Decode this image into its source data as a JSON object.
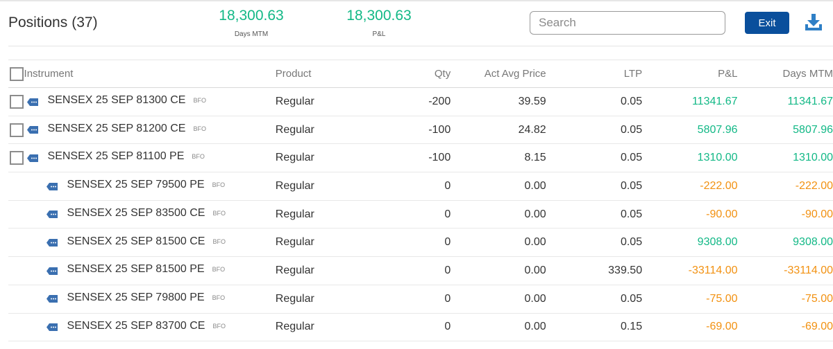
{
  "header": {
    "title": "Positions",
    "count": "(37)",
    "days_mtm_value": "18,300.63",
    "days_mtm_label": "Days MTM",
    "pnl_value": "18,300.63",
    "pnl_label": "P&L",
    "search_placeholder": "Search",
    "exit_label": "Exit"
  },
  "columns": {
    "instrument": "Instrument",
    "product": "Product",
    "qty": "Qty",
    "avg": "Act Avg Price",
    "ltp": "LTP",
    "pnl": "P&L",
    "mtm": "Days MTM"
  },
  "colors": {
    "profit": "#12b886",
    "loss": "#f29111",
    "accent": "#0a4f9c"
  },
  "rows": [
    {
      "instrument": "SENSEX 25 SEP 81300 CE",
      "exchange": "BFO",
      "product": "Regular",
      "qty": "-200",
      "avg": "39.59",
      "ltp": "0.05",
      "pnl": "11341.67",
      "mtm": "11341.67",
      "checkbox": true,
      "status": "profit"
    },
    {
      "instrument": "SENSEX 25 SEP 81200 CE",
      "exchange": "BFO",
      "product": "Regular",
      "qty": "-100",
      "avg": "24.82",
      "ltp": "0.05",
      "pnl": "5807.96",
      "mtm": "5807.96",
      "checkbox": true,
      "status": "profit"
    },
    {
      "instrument": "SENSEX 25 SEP 81100 PE",
      "exchange": "BFO",
      "product": "Regular",
      "qty": "-100",
      "avg": "8.15",
      "ltp": "0.05",
      "pnl": "1310.00",
      "mtm": "1310.00",
      "checkbox": true,
      "status": "profit"
    },
    {
      "instrument": "SENSEX 25 SEP 79500 PE",
      "exchange": "BFO",
      "product": "Regular",
      "qty": "0",
      "avg": "0.00",
      "ltp": "0.05",
      "pnl": "-222.00",
      "mtm": "-222.00",
      "checkbox": false,
      "status": "loss"
    },
    {
      "instrument": "SENSEX 25 SEP 83500 CE",
      "exchange": "BFO",
      "product": "Regular",
      "qty": "0",
      "avg": "0.00",
      "ltp": "0.05",
      "pnl": "-90.00",
      "mtm": "-90.00",
      "checkbox": false,
      "status": "loss"
    },
    {
      "instrument": "SENSEX 25 SEP 81500 CE",
      "exchange": "BFO",
      "product": "Regular",
      "qty": "0",
      "avg": "0.00",
      "ltp": "0.05",
      "pnl": "9308.00",
      "mtm": "9308.00",
      "checkbox": false,
      "status": "profit"
    },
    {
      "instrument": "SENSEX 25 SEP 81500 PE",
      "exchange": "BFO",
      "product": "Regular",
      "qty": "0",
      "avg": "0.00",
      "ltp": "339.50",
      "pnl": "-33114.00",
      "mtm": "-33114.00",
      "checkbox": false,
      "status": "loss"
    },
    {
      "instrument": "SENSEX 25 SEP 79800 PE",
      "exchange": "BFO",
      "product": "Regular",
      "qty": "0",
      "avg": "0.00",
      "ltp": "0.05",
      "pnl": "-75.00",
      "mtm": "-75.00",
      "checkbox": false,
      "status": "loss"
    },
    {
      "instrument": "SENSEX 25 SEP 83700 CE",
      "exchange": "BFO",
      "product": "Regular",
      "qty": "0",
      "avg": "0.00",
      "ltp": "0.15",
      "pnl": "-69.00",
      "mtm": "-69.00",
      "checkbox": false,
      "status": "loss"
    }
  ]
}
